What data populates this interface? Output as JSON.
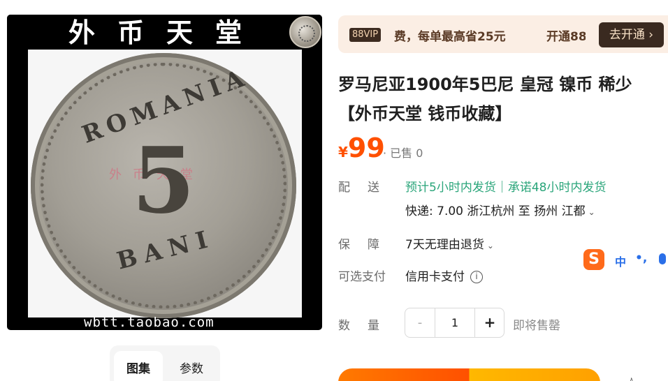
{
  "gallery": {
    "shop_banner": "外币天堂",
    "coin_country": "ROMANIA",
    "coin_value": "5",
    "coin_unit": "BANI",
    "coin_watermark": "外币天堂",
    "watermark_url": "wbtt.taobao.com",
    "tabs": [
      "图集",
      "参数"
    ]
  },
  "vip": {
    "badge": "88VIP",
    "text": "费，每单最高省25元",
    "open_text": "开通88",
    "button": "去开通 ›"
  },
  "product": {
    "title": "罗马尼亚1900年5巴尼 皇冠 镍币 稀少【外币天堂 钱币收藏】",
    "currency": "¥",
    "price": "99",
    "sold": "· 已售 0"
  },
  "shipping": {
    "label": "配送",
    "promise": "预计5小时内发货｜承诺48小时内发货",
    "detail": "快递: 7.00  浙江杭州  至  扬州 江都"
  },
  "guarantee": {
    "label": "保障",
    "value": "7天无理由退货"
  },
  "payment": {
    "label": "可选支付",
    "value": "信用卡支付"
  },
  "quantity": {
    "label": "数量",
    "minus": "-",
    "value": "1",
    "plus": "+",
    "note": "即将售罄"
  },
  "ime": {
    "logo": "S",
    "mode": "中",
    "punct": "•,"
  },
  "colors": {
    "price": "#ff5000",
    "shipping_promise": "#2aa57a",
    "vip_bg": "#fbeee4",
    "vip_button": "#3a2a20"
  }
}
